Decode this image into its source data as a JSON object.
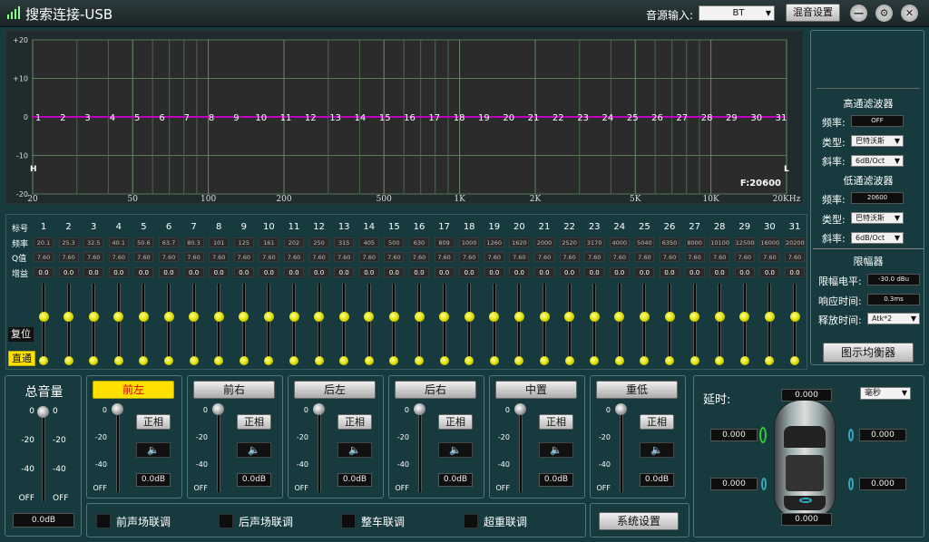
{
  "title": "搜索连接-USB",
  "source_label": "音源输入:",
  "source_value": "BT",
  "mix_btn": "混音设置",
  "graph": {
    "y_ticks": [
      "+20",
      "+10",
      "0",
      "-10",
      "-20"
    ],
    "x_ticks": [
      "20",
      "50",
      "100",
      "200",
      "500",
      "1K",
      "2K",
      "5K",
      "10K",
      "20KHz"
    ],
    "left_marker": "H",
    "right_marker": "L",
    "freq_readout": "F:20600"
  },
  "bands": [
    "1",
    "2",
    "3",
    "4",
    "5",
    "6",
    "7",
    "8",
    "9",
    "10",
    "11",
    "12",
    "13",
    "14",
    "15",
    "16",
    "17",
    "18",
    "19",
    "20",
    "21",
    "22",
    "23",
    "24",
    "25",
    "26",
    "27",
    "28",
    "29",
    "30",
    "31"
  ],
  "freqs": [
    "20.1",
    "25.3",
    "32.5",
    "40.1",
    "50.6",
    "63.7",
    "80.3",
    "101",
    "125",
    "161",
    "202",
    "250",
    "315",
    "405",
    "500",
    "630",
    "809",
    "1000",
    "1260",
    "1620",
    "2000",
    "2520",
    "3170",
    "4000",
    "5040",
    "6350",
    "8000",
    "10100",
    "12500",
    "16000",
    "20200"
  ],
  "q_values": [
    "7.60",
    "7.60",
    "7.60",
    "7.60",
    "7.60",
    "7.60",
    "7.60",
    "7.60",
    "7.60",
    "7.60",
    "7.60",
    "7.60",
    "7.60",
    "7.60",
    "7.60",
    "7.60",
    "7.60",
    "7.60",
    "7.60",
    "7.60",
    "7.60",
    "7.60",
    "7.60",
    "7.60",
    "7.60",
    "7.60",
    "7.60",
    "7.60",
    "7.60",
    "7.60",
    "7.60"
  ],
  "gains": [
    "0.0",
    "0.0",
    "0.0",
    "0.0",
    "0.0",
    "0.0",
    "0.0",
    "0.0",
    "0.0",
    "0.0",
    "0.0",
    "0.0",
    "0.0",
    "0.0",
    "0.0",
    "0.0",
    "0.0",
    "0.0",
    "0.0",
    "0.0",
    "0.0",
    "0.0",
    "0.0",
    "0.0",
    "0.0",
    "0.0",
    "0.0",
    "0.0",
    "0.0",
    "0.0",
    "0.0"
  ],
  "row_labels": {
    "band": "标号",
    "freq": "频率",
    "q": "Q值",
    "gain": "增益"
  },
  "reset": "复位",
  "bypass": "直通",
  "hpf": {
    "title": "高通滤波器",
    "freq_label": "频率:",
    "freq": "OFF",
    "type_label": "类型:",
    "type": "巴特沃斯",
    "slope_label": "斜率:",
    "slope": "6dB/Oct"
  },
  "lpf": {
    "title": "低通滤波器",
    "freq_label": "频率:",
    "freq": "20600",
    "type_label": "类型:",
    "type": "巴特沃斯",
    "slope_label": "斜率:",
    "slope": "6dB/Oct"
  },
  "limiter": {
    "title": "限幅器",
    "level_label": "限幅电平:",
    "level": "-30.0 dBu",
    "response_label": "响应时间:",
    "response": "0.3ms",
    "release_label": "释放时间:",
    "release": "Atk*2"
  },
  "graphic_eq_btn": "图示均衡器",
  "master": {
    "title": "总音量",
    "ticks": [
      "0",
      "-20",
      "-40",
      "OFF"
    ],
    "value": "0.0dB"
  },
  "channels": [
    {
      "name": "前左",
      "active": true,
      "phase": "正相",
      "value": "0.0dB"
    },
    {
      "name": "前右",
      "active": false,
      "phase": "正相",
      "value": "0.0dB"
    },
    {
      "name": "后左",
      "active": false,
      "phase": "正相",
      "value": "0.0dB"
    },
    {
      "name": "后右",
      "active": false,
      "phase": "正相",
      "value": "0.0dB"
    },
    {
      "name": "中置",
      "active": false,
      "phase": "正相",
      "value": "0.0dB"
    },
    {
      "name": "重低",
      "active": false,
      "phase": "正相",
      "value": "0.0dB"
    }
  ],
  "ch_ticks": [
    "0",
    "-20",
    "-40",
    "OFF"
  ],
  "links": [
    "前声场联调",
    "后声场联调",
    "整车联调",
    "超重联调"
  ],
  "system_btn": "系统设置",
  "delay": {
    "title": "延时:",
    "unit": "毫秒",
    "top": "0.000",
    "fl": "0.000",
    "fr": "0.000",
    "rl": "0.000",
    "rr": "0.000",
    "bottom": "0.000"
  },
  "colors": {
    "accent": "#ffe000",
    "curve": "#c000c0",
    "bg": "#173a3e"
  }
}
